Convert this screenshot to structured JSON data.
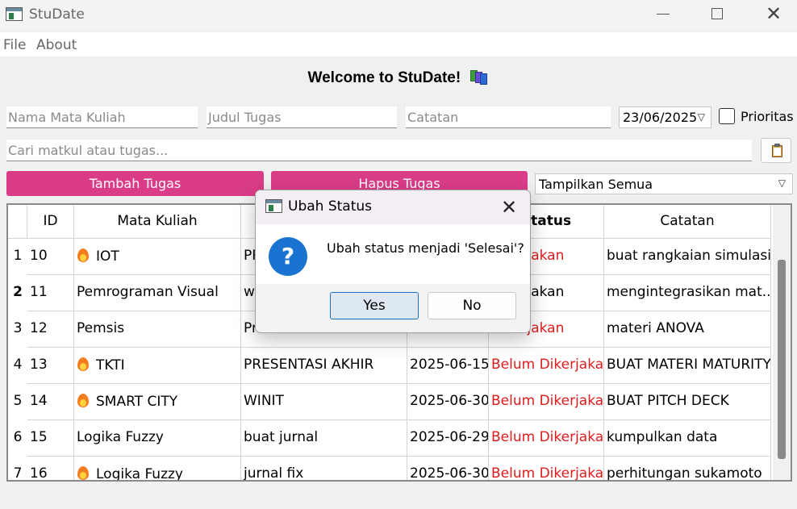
{
  "window": {
    "title": "StuDate"
  },
  "menu": [
    "File",
    "About"
  ],
  "welcome": "Welcome to StuDate!",
  "form": {
    "matkul_placeholder": "Nama Mata Kuliah",
    "judul_placeholder": "Judul Tugas",
    "catatan_placeholder": "Catatan",
    "date": "23/06/2025",
    "prioritas_label": "Prioritas",
    "search_placeholder": "Cari matkul atau tugas..."
  },
  "buttons": {
    "add": "Tambah Tugas",
    "delete": "Hapus Tugas"
  },
  "filter": {
    "selected": "Tampilkan Semua"
  },
  "table": {
    "headers": [
      "ID",
      "Mata Kuliah",
      "",
      "",
      "Status",
      "Catatan"
    ],
    "rows": [
      {
        "num": "1",
        "id": "10",
        "matkul": "IOT",
        "judul": "PR",
        "deadline": "",
        "status": "Dikerjakan",
        "catatan": "buat rangkaian simulasi",
        "priority": true
      },
      {
        "num": "2",
        "id": "11",
        "matkul": "Pemrograman Visual",
        "judul": "w",
        "deadline": "",
        "status": "Dikerjakan",
        "catatan": "mengintegrasikan mat...",
        "priority": false
      },
      {
        "num": "3",
        "id": "12",
        "matkul": "Pemsis",
        "judul": "Pr",
        "deadline": "",
        "status": "Dikerjakan",
        "catatan": "materi ANOVA",
        "priority": false
      },
      {
        "num": "4",
        "id": "13",
        "matkul": "TKTI",
        "judul": "PRESENTASI AKHIR",
        "deadline": "2025-06-15",
        "status": "Belum Dikerjakan",
        "catatan": "BUAT MATERI MATURITY",
        "priority": true
      },
      {
        "num": "5",
        "id": "14",
        "matkul": "SMART CITY",
        "judul": "WINIT",
        "deadline": "2025-06-30",
        "status": "Belum Dikerjakan",
        "catatan": "BUAT PITCH DECK",
        "priority": true
      },
      {
        "num": "6",
        "id": "15",
        "matkul": "Logika Fuzzy",
        "judul": "buat jurnal",
        "deadline": "2025-06-29",
        "status": "Belum Dikerjakan",
        "catatan": "kumpulkan data",
        "priority": false
      },
      {
        "num": "7",
        "id": "16",
        "matkul": "Logika Fuzzy",
        "judul": "jurnal fix",
        "deadline": "2025-06-30",
        "status": "Belum Dikerjakan",
        "catatan": "perhitungan sukamoto",
        "priority": true
      }
    ]
  },
  "dialog": {
    "title": "Ubah Status",
    "message": "Ubah status menjadi 'Selesai'?",
    "yes": "Yes",
    "no": "No"
  },
  "colors": {
    "accent": "#db3c88",
    "status_red": "#e01b1b",
    "question_blue": "#1a73d1"
  }
}
